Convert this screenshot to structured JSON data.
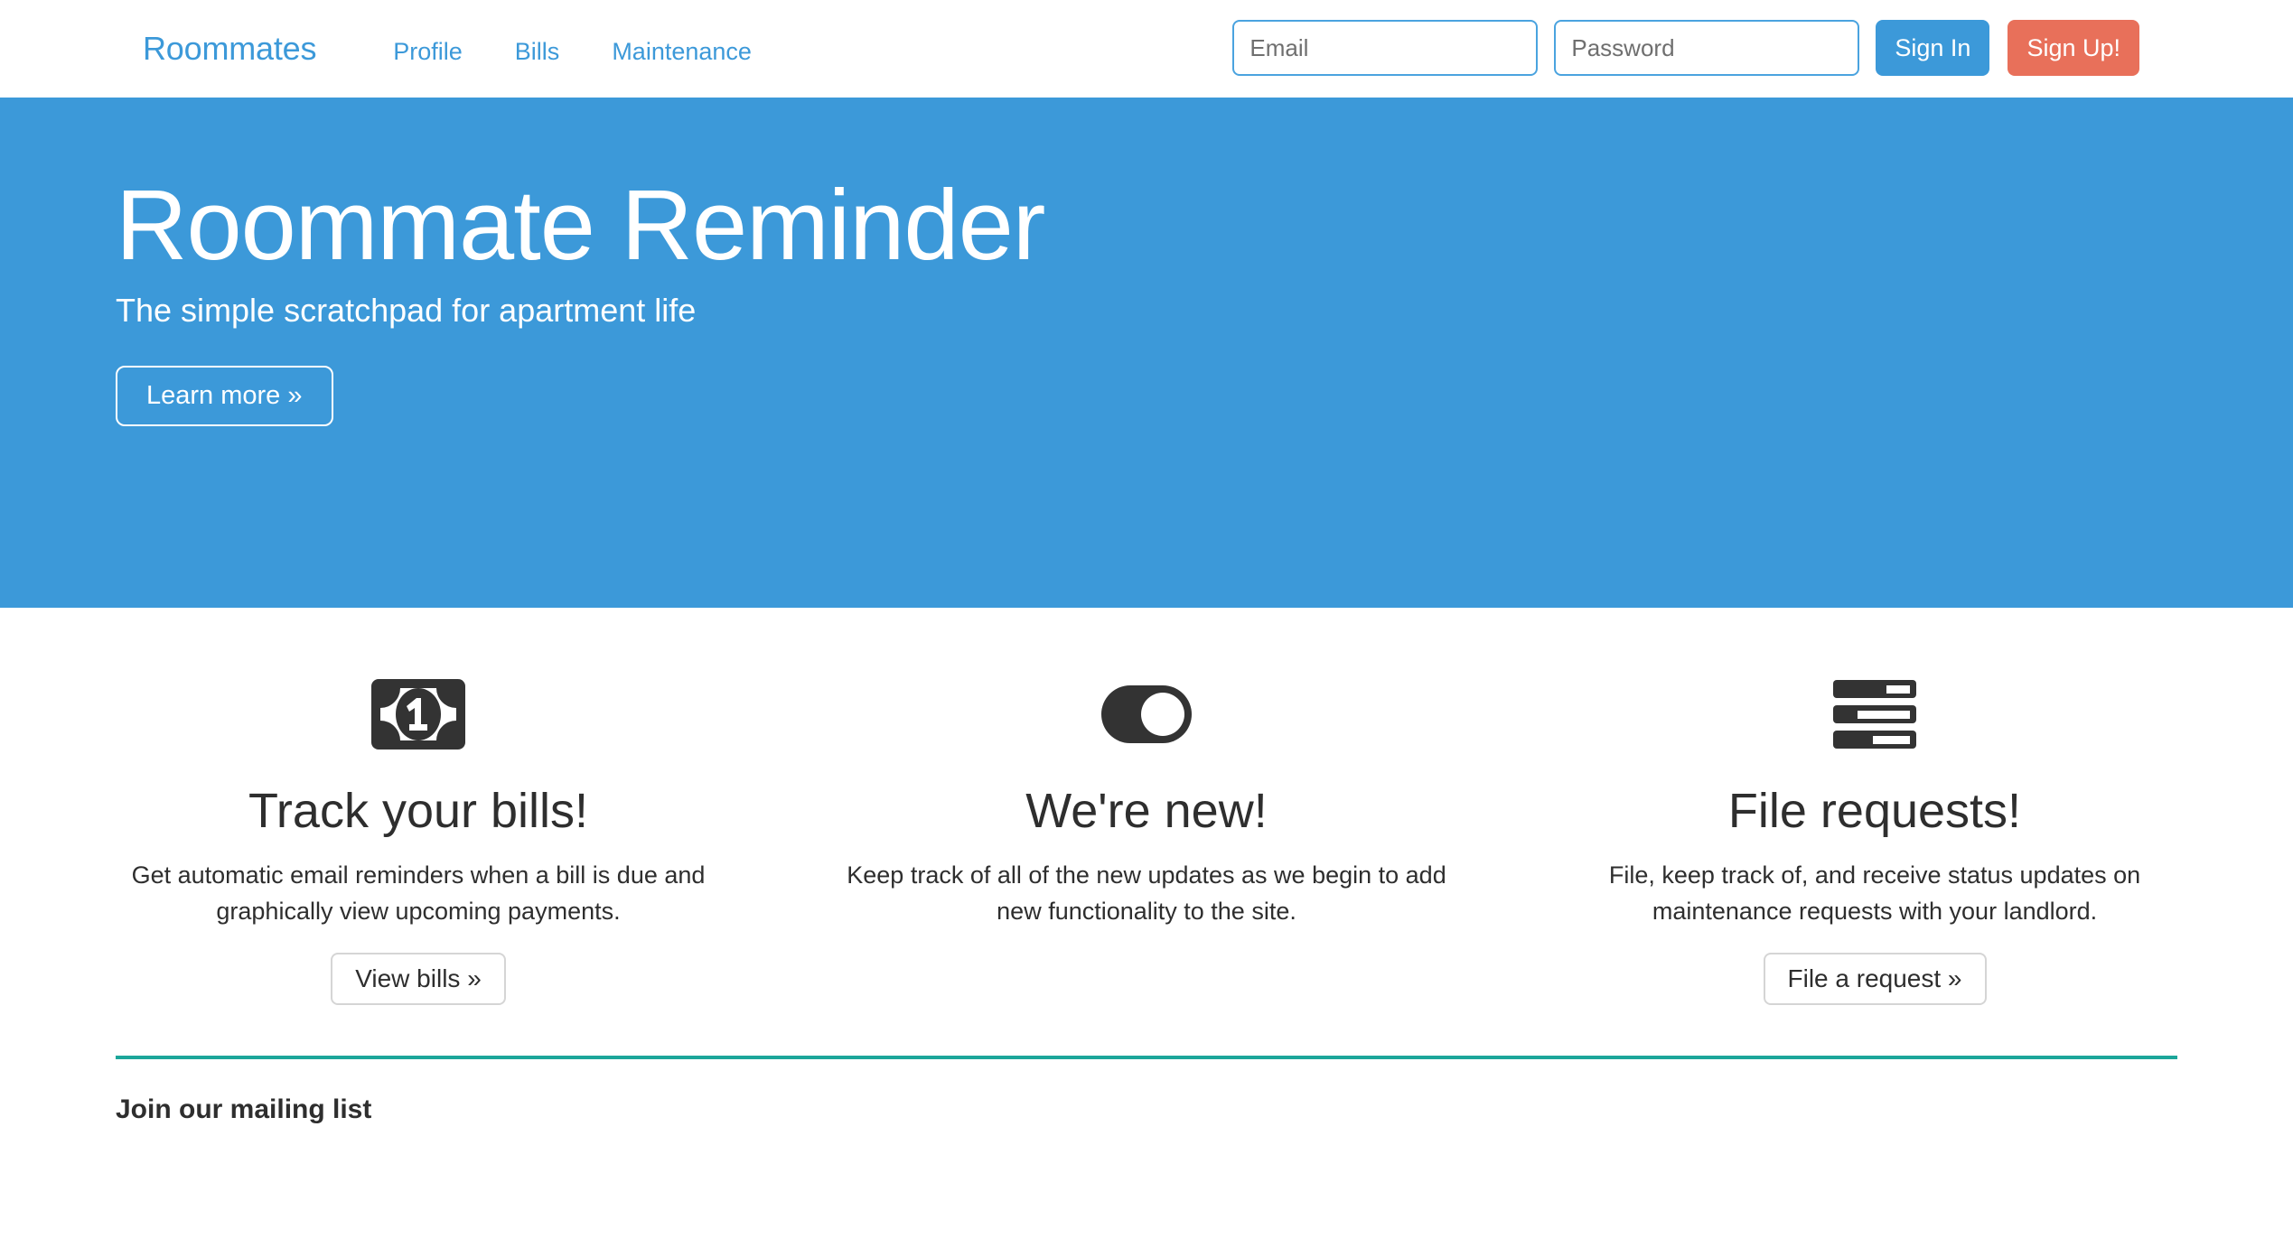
{
  "navbar": {
    "brand": "Roommates",
    "links": [
      {
        "label": "Profile"
      },
      {
        "label": "Bills"
      },
      {
        "label": "Maintenance"
      }
    ],
    "email_placeholder": "Email",
    "email_value": "",
    "password_placeholder": "Password",
    "password_value": "",
    "signin_label": "Sign In",
    "signup_label": "Sign Up!"
  },
  "hero": {
    "title": "Roommate Reminder",
    "subtitle": "The simple scratchpad for apartment life",
    "cta_label": "Learn more »"
  },
  "features": [
    {
      "icon": "money-bill-icon",
      "title": "Track your bills!",
      "description": "Get automatic email reminders when a bill is due and graphically view upcoming payments.",
      "cta_label": "View bills »"
    },
    {
      "icon": "toggle-on-icon",
      "title": "We're new!",
      "description": "Keep track of all of the new updates as we begin to add new functionality to the site.",
      "cta_label": ""
    },
    {
      "icon": "task-list-icon",
      "title": "File requests!",
      "description": "File, keep track of, and receive status updates on maintenance requests with your landlord.",
      "cta_label": "File a request »"
    }
  ],
  "footer": {
    "mailing_title": "Join our mailing list"
  },
  "colors": {
    "brand_blue": "#3c99d9",
    "accent_coral": "#e8705a",
    "divider_teal": "#1ca69a",
    "icon_dark": "#333333"
  }
}
